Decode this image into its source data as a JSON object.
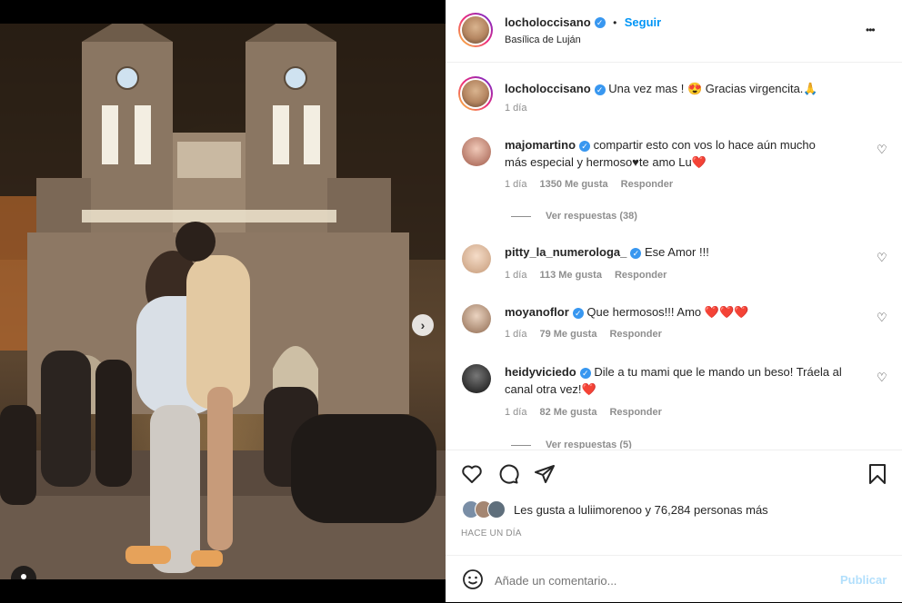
{
  "post": {
    "author": "locholoccisano",
    "separator": "•",
    "follow_label": "Seguir",
    "location": "Basílica de Luján",
    "more_glyph": "•••"
  },
  "caption": {
    "author": "locholoccisano",
    "text": "Una vez mas ! 😍 Gracias virgencita.🙏",
    "time": "1 día"
  },
  "comments": [
    {
      "user": "majomartino",
      "text_line1": "compartir esto con vos lo hace aún mucho",
      "text_line2": "más especial y hermoso♥te amo Lu❤️",
      "time": "1 día",
      "likes": "1350 Me gusta",
      "reply_label": "Responder",
      "view_replies": "Ver respuestas (38)"
    },
    {
      "user": "pitty_la_numerologa_",
      "text_line1": "Ese Amor !!!",
      "time": "1 día",
      "likes": "113 Me gusta",
      "reply_label": "Responder"
    },
    {
      "user": "moyanoflor",
      "text_line1": "Que hermosos!!! Amo ❤️❤️❤️",
      "time": "1 día",
      "likes": "79 Me gusta",
      "reply_label": "Responder"
    },
    {
      "user": "heidyviciedo",
      "text_line1": "Dile a tu mami que le mando un beso! Tráela al",
      "text_line2": "canal otra vez!❤️",
      "time": "1 día",
      "likes": "82 Me gusta",
      "reply_label": "Responder",
      "view_replies": "Ver respuestas (5)"
    }
  ],
  "likes_summary": {
    "prefix": "Les gusta a ",
    "user": "luliimorenoo",
    "suffix": " y 76,284 personas más"
  },
  "post_time": "HACE UN DÍA",
  "add_comment": {
    "placeholder": "Añade un comentario...",
    "publish_label": "Publicar"
  },
  "icons": {
    "like": "heart-outline-icon",
    "comment": "comment-bubble-icon",
    "share": "paper-plane-icon",
    "save": "bookmark-icon",
    "emoji": "smiley-icon",
    "next": "chevron-right-icon",
    "tag": "user-tag-icon"
  },
  "colors": {
    "link_blue": "#0095f6",
    "verified_blue": "#3897f0",
    "text_primary": "#262626",
    "text_muted": "#8e8e8e",
    "publish_disabled": "#b2dffc"
  },
  "carousel": {
    "count": 2,
    "active_index": 1
  }
}
